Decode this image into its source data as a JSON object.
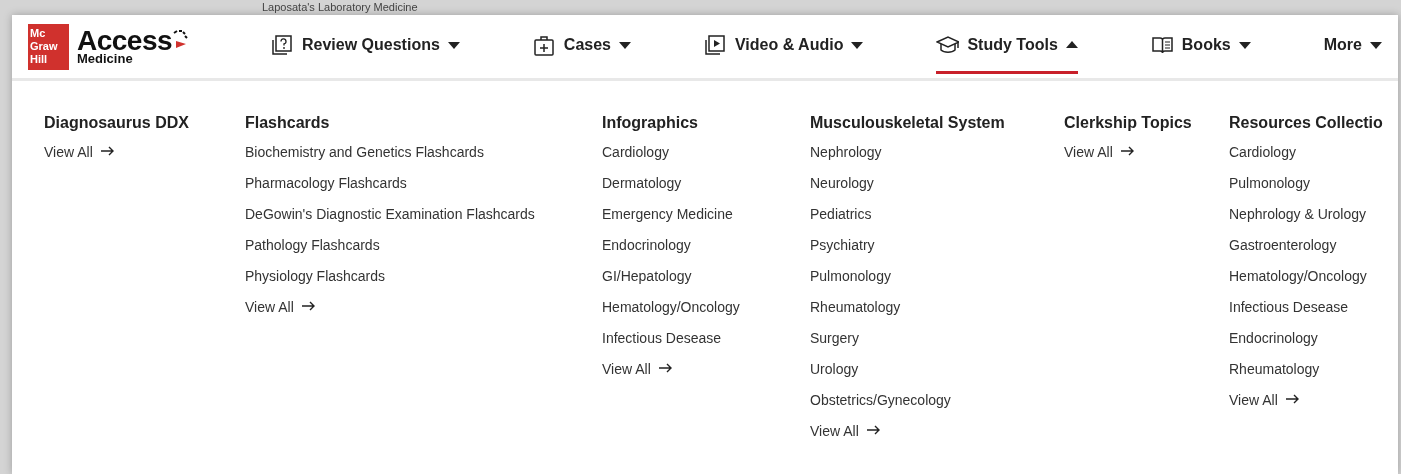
{
  "background_text": "Laposata's Laboratory Medicine",
  "logo": {
    "brand_lines": [
      "Mc",
      "Graw",
      "Hill"
    ],
    "title": "Access",
    "subtitle": "Medicine"
  },
  "nav": [
    {
      "label": "Review Questions",
      "kind": "question",
      "expanded": false,
      "selected": false
    },
    {
      "label": "Cases",
      "kind": "case",
      "expanded": false,
      "selected": false
    },
    {
      "label": "Video & Audio",
      "kind": "video",
      "expanded": false,
      "selected": false
    },
    {
      "label": "Study Tools",
      "kind": "cap",
      "expanded": true,
      "selected": true
    },
    {
      "label": "Books",
      "kind": "book",
      "expanded": false,
      "selected": false
    },
    {
      "label": "More",
      "kind": "plain",
      "expanded": false,
      "selected": false
    }
  ],
  "menu_columns": [
    {
      "heading": "Diagnosaurus DDX",
      "view_all": "View All"
    },
    {
      "heading": "Flashcards",
      "links": [
        "Biochemistry and Genetics Flashcards",
        "Pharmacology Flashcards",
        "DeGowin's Diagnostic Examination Flashcards",
        "Pathology Flashcards",
        "Physiology Flashcards"
      ],
      "view_all": "View All"
    },
    {
      "heading": "Infographics",
      "links": [
        "Cardiology",
        "Dermatology",
        "Emergency Medicine",
        "Endocrinology",
        "GI/Hepatology",
        "Hematology/Oncology",
        "Infectious Desease"
      ],
      "view_all": "View All"
    },
    {
      "heading": "Musculouskeletal System",
      "links": [
        "Nephrology",
        "Neurology",
        "Pediatrics",
        "Psychiatry",
        "Pulmonology",
        "Rheumatology",
        "Surgery",
        "Urology",
        "Obstetrics/Gynecology"
      ],
      "view_all": "View All"
    },
    {
      "heading": "Clerkship Topics",
      "view_all": "View All"
    },
    {
      "heading": "Resources Collectio",
      "links": [
        "Cardiology",
        "Pulmonology",
        "Nephrology & Urology",
        "Gastroenterology",
        "Hematology/Oncology",
        "Infectious Desease",
        "Endocrinology",
        "Rheumatology"
      ],
      "view_all": "View All"
    }
  ]
}
